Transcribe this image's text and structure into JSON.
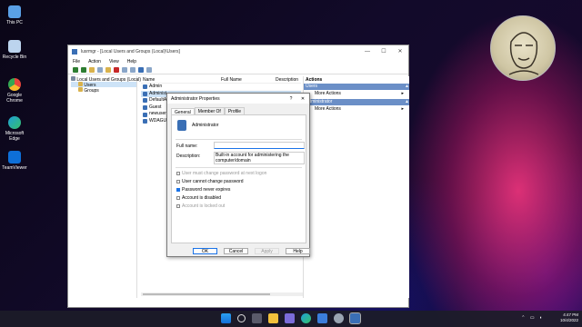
{
  "desktop": {
    "icons": [
      {
        "label": "This PC",
        "icon": "monitor-icon",
        "color": "#5aa0e6"
      },
      {
        "label": "Recycle Bin",
        "icon": "recycle-bin-icon",
        "color": "#bcd4ee"
      },
      {
        "label": "Google Chrome",
        "icon": "chrome-icon",
        "color": "#e8453c"
      },
      {
        "label": "Microsoft Edge",
        "icon": "edge-icon",
        "color": "#1fa0d8"
      },
      {
        "label": "TeamViewer",
        "icon": "teamviewer-icon",
        "color": "#0e6fd8"
      }
    ]
  },
  "window": {
    "title": "lusrmgr - [Local Users and Groups (Local)\\Users]",
    "menu": [
      "File",
      "Action",
      "View",
      "Help"
    ],
    "tree": {
      "root": "Local Users and Groups (Local)",
      "items": [
        "Users",
        "Groups"
      ]
    },
    "list": {
      "columns": [
        "Name",
        "Full Name",
        "Description"
      ],
      "rows": [
        "Admin",
        "Administ",
        "DefaultAc",
        "Guest",
        "newuser",
        "WDAGUtilit"
      ]
    },
    "actions": {
      "title": "Actions",
      "sections": [
        {
          "label": "Users",
          "item": "More Actions"
        },
        {
          "label": "Administrator",
          "item": "More Actions"
        }
      ]
    }
  },
  "dialog": {
    "title": "Administrator Properties",
    "help": "?",
    "close": "✕",
    "tabs": [
      "General",
      "Member Of",
      "Profile"
    ],
    "username": "Administrator",
    "full_name_label": "Full name:",
    "full_name_value": "",
    "description_label": "Description:",
    "description_value": "Built-in account for administering the computer/domain",
    "checkboxes": [
      {
        "label": "User must change password at next logon",
        "checked": false,
        "enabled": false
      },
      {
        "label": "User cannot change password",
        "checked": false,
        "enabled": true
      },
      {
        "label": "Password never expires",
        "checked": true,
        "enabled": true
      },
      {
        "label": "Account is disabled",
        "checked": false,
        "enabled": true
      },
      {
        "label": "Account is locked out",
        "checked": false,
        "enabled": false
      }
    ],
    "buttons": {
      "ok": "OK",
      "cancel": "Cancel",
      "apply": "Apply",
      "help": "Help"
    }
  },
  "taskbar": {
    "icons": [
      "windows-start-icon",
      "search-icon",
      "task-view-icon",
      "file-explorer-icon",
      "chat-icon",
      "edge-icon",
      "store-icon",
      "settings-icon",
      "lusrmgr-icon"
    ],
    "time": "4:47 PM",
    "date": "10/4/2022"
  }
}
